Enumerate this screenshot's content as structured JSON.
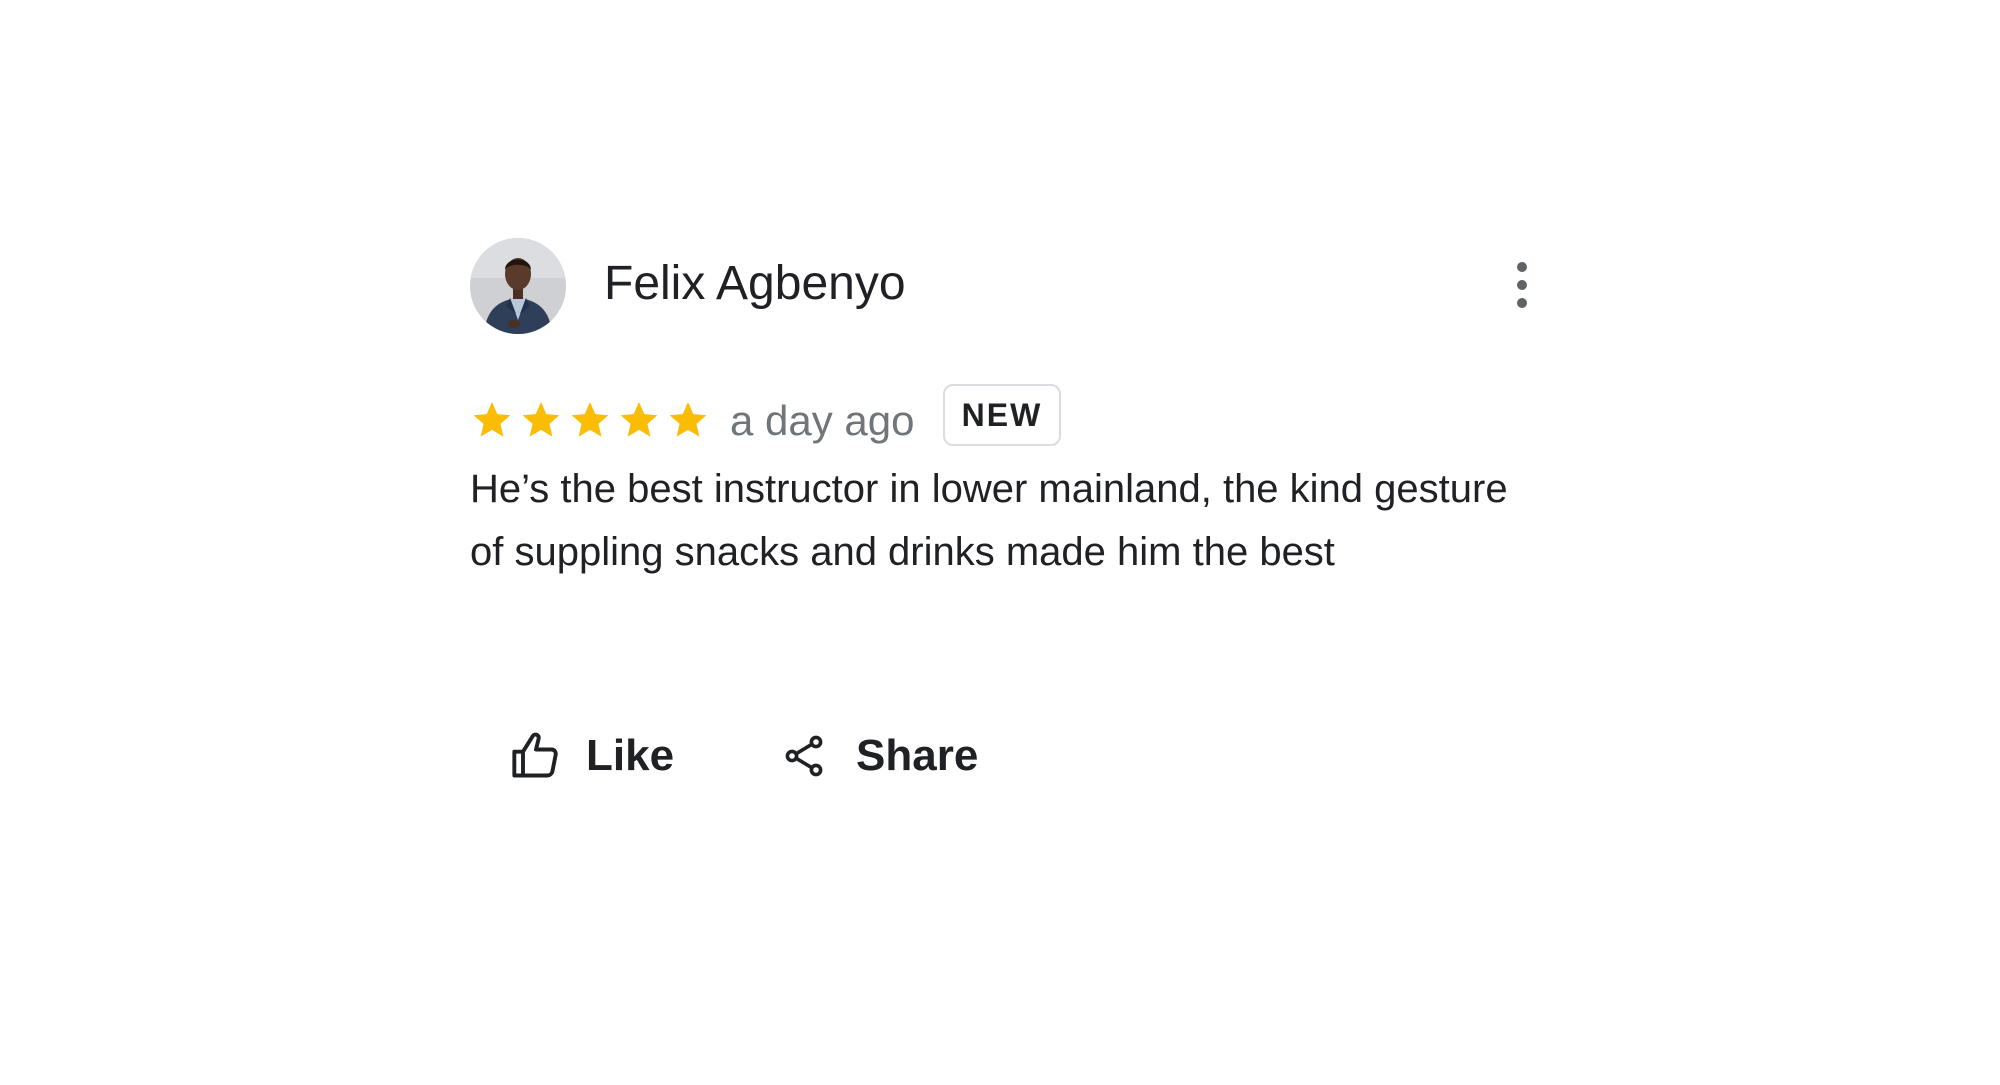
{
  "review": {
    "reviewer_name": "Felix Agbenyo",
    "avatar_icon": "profile-photo",
    "rating": 5,
    "rating_max": 5,
    "star_color": "#fbbc04",
    "timestamp": "a day ago",
    "badge": "NEW",
    "text": "He’s the best instructor in lower mainland, the kind gesture of suppling snacks and drinks made him the best",
    "more_icon": "more-vert-icon"
  },
  "actions": {
    "like_label": "Like",
    "like_icon": "thumb-up-icon",
    "share_label": "Share",
    "share_icon": "share-icon"
  }
}
